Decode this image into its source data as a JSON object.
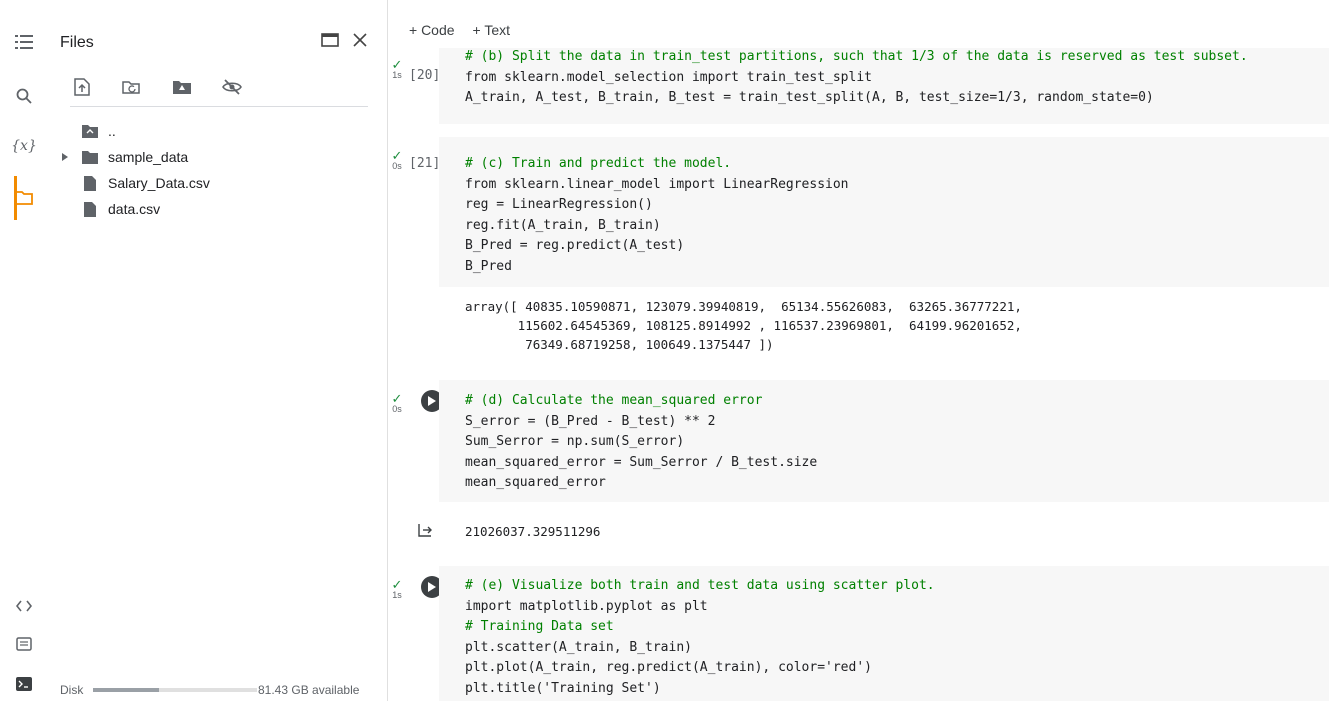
{
  "rail": {
    "icons": [
      "toc-icon",
      "search-icon",
      "variables-icon",
      "folder-icon",
      "code-snippets-icon",
      "command-palette-icon",
      "terminal-icon"
    ],
    "variables_label": "{x}"
  },
  "files_panel": {
    "title": "Files",
    "toolbar": [
      "upload-icon",
      "refresh-icon",
      "mount-drive-icon",
      "hide-files-icon"
    ],
    "tree": [
      {
        "label": "..",
        "kind": "parent-folder"
      },
      {
        "label": "sample_data",
        "kind": "folder"
      },
      {
        "label": "Salary_Data.csv",
        "kind": "file"
      },
      {
        "label": "data.csv",
        "kind": "file"
      }
    ],
    "disk_label": "Disk",
    "disk_used_fraction": 0.4,
    "disk_available": "81.43 GB available"
  },
  "notebook": {
    "add_code": "+ Code",
    "add_text": "+ Text",
    "cells": [
      {
        "exec": "[20]",
        "status_time": "1s",
        "lines": [
          "# (b) Split the data in train_test partitions, such that 1/3 of the data is reserved as test subset.",
          "from sklearn.model_selection import train_test_split",
          "A_train, A_test, B_train, B_test = train_test_split(A, B, test_size=1/3, random_state=0)"
        ]
      },
      {
        "exec": "[21]",
        "status_time": "0s",
        "lines": [
          "# (c) Train and predict the model.",
          "from sklearn.linear_model import LinearRegression",
          "reg = LinearRegression()",
          "reg.fit(A_train, B_train)",
          "B_Pred = reg.predict(A_test)",
          "B_Pred"
        ],
        "output": "array([ 40835.10590871, 123079.39940819,  65134.55626083,  63265.36777221,\n       115602.64545369, 108125.8914992 , 116537.23969801,  64199.96201652,\n        76349.68719258, 100649.1375447 ])"
      },
      {
        "exec": "",
        "status_time": "0s",
        "lines": [
          "# (d) Calculate the mean_squared error",
          "S_error = (B_Pred - B_test) ** 2",
          "Sum_Serror = np.sum(S_error)",
          "mean_squared_error = Sum_Serror / B_test.size",
          "mean_squared_error"
        ],
        "output": "21026037.329511296"
      },
      {
        "exec": "",
        "status_time": "1s",
        "lines": [
          "# (e) Visualize both train and test data using scatter plot.",
          "import matplotlib.pyplot as plt",
          "# Training Data set",
          "plt.scatter(A_train, B_train)",
          "plt.plot(A_train, reg.predict(A_train), color='red')",
          "plt.title('Training Set')"
        ]
      }
    ]
  },
  "colors": {
    "accent": "#f28b00",
    "check": "#1e8e3e",
    "cell_bg": "#f7f7f7"
  }
}
